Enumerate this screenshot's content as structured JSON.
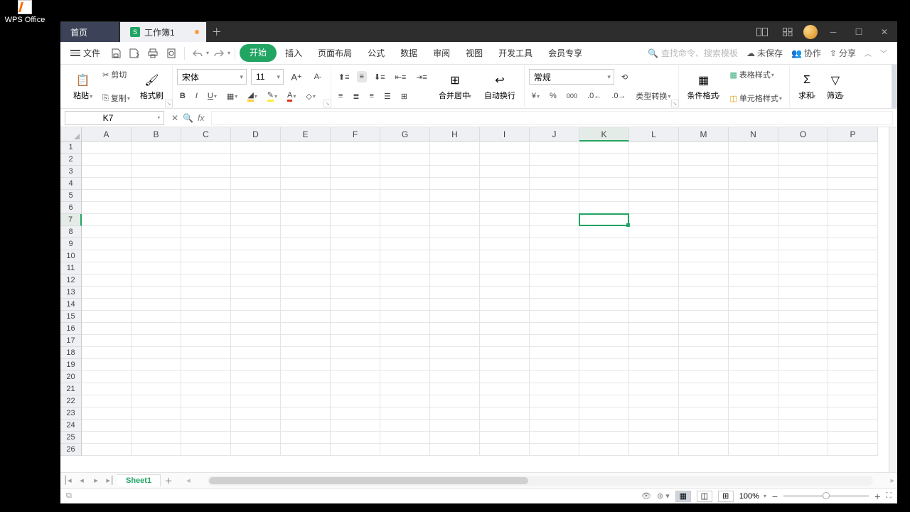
{
  "desktop": {
    "app_label": "WPS Office"
  },
  "tabs": {
    "home": "首页",
    "doc": "工作簿1"
  },
  "menubar": {
    "file": "文件",
    "items": [
      "开始",
      "插入",
      "页面布局",
      "公式",
      "数据",
      "审阅",
      "视图",
      "开发工具",
      "会员专享"
    ],
    "search_placeholder": "查找命令、搜索模板",
    "unsaved": "未保存",
    "collab": "协作",
    "share": "分享"
  },
  "ribbon": {
    "paste": "粘贴",
    "cut": "剪切",
    "copy": "复制",
    "format_painter": "格式刷",
    "font_name": "宋体",
    "font_size": "11",
    "merge_center": "合并居中",
    "wrap_text": "自动换行",
    "number_format": "常规",
    "type_convert": "类型转换",
    "cond_format": "条件格式",
    "table_style": "表格样式",
    "cell_style": "单元格样式",
    "sum": "求和",
    "filter": "筛选"
  },
  "namebox": "K7",
  "columns": [
    "A",
    "B",
    "C",
    "D",
    "E",
    "F",
    "G",
    "H",
    "I",
    "J",
    "K",
    "L",
    "M",
    "N",
    "O",
    "P"
  ],
  "rows": 26,
  "selected": {
    "col": "K",
    "row": 7
  },
  "sheet": {
    "name": "Sheet1"
  },
  "status": {
    "zoom": "100%"
  }
}
